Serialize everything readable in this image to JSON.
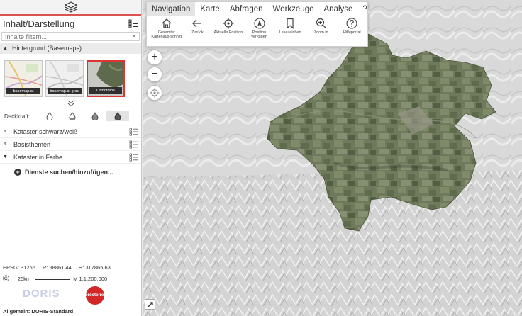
{
  "sidebar": {
    "title": "Inhalt/Darstellung",
    "filter_placeholder": "Inhalte filtern...",
    "clear_symbol": "×",
    "basemap_section": "Hintergrund (Basemaps)",
    "basemaps": [
      "basemap.at",
      "basemap.at grau",
      "Orthofotos"
    ],
    "active_basemap": "Orthofotos",
    "opacity_label": "Deckkraft:",
    "layers": [
      {
        "label": "Kataster schwarz/weiß",
        "expanded": false
      },
      {
        "label": "Basisthemen",
        "expanded": false
      },
      {
        "label": "Kataster in Farbe",
        "expanded": true
      }
    ],
    "add_services": "Dienste suchen/hinzufügen...",
    "footer": "Allgemein: DORIS-Standard"
  },
  "status": {
    "epsg_label": "EPSG:",
    "epsg_value": "31255",
    "r_label": "R:",
    "r_value": "98861.44",
    "h_label": "H:",
    "h_value": "317865.63",
    "scale_distance": "25km",
    "scale_ratio": "M 1:1.200.000",
    "copyright_symbol": "©"
  },
  "logos": {
    "doris": "DORIS",
    "ooe": "oberösterreich"
  },
  "toolbar": {
    "tabs": [
      "Navigation",
      "Karte",
      "Abfragen",
      "Werkzeuge",
      "Analyse",
      "?"
    ],
    "active_tab": "Navigation",
    "tools": [
      {
        "label": "Gesamter Kartenaus-schnitt",
        "icon": "home-icon"
      },
      {
        "label": "Zurück",
        "icon": "arrow-left-icon"
      },
      {
        "label": "Aktuelle Position",
        "icon": "locate-icon"
      },
      {
        "label": "Position verfolgen",
        "icon": "navigation-arrow-icon"
      },
      {
        "label": "Lesezeichen",
        "icon": "bookmark-icon"
      },
      {
        "label": "Zoom in",
        "icon": "zoom-in-icon"
      },
      {
        "label": "Hilfeportal",
        "icon": "help-icon"
      }
    ]
  },
  "map_controls": {
    "zoom_in": "+",
    "zoom_out": "−"
  },
  "colors": {
    "accent": "#d9534f",
    "panel_bg": "#ffffff",
    "active_tab": "#e4e4e4"
  }
}
